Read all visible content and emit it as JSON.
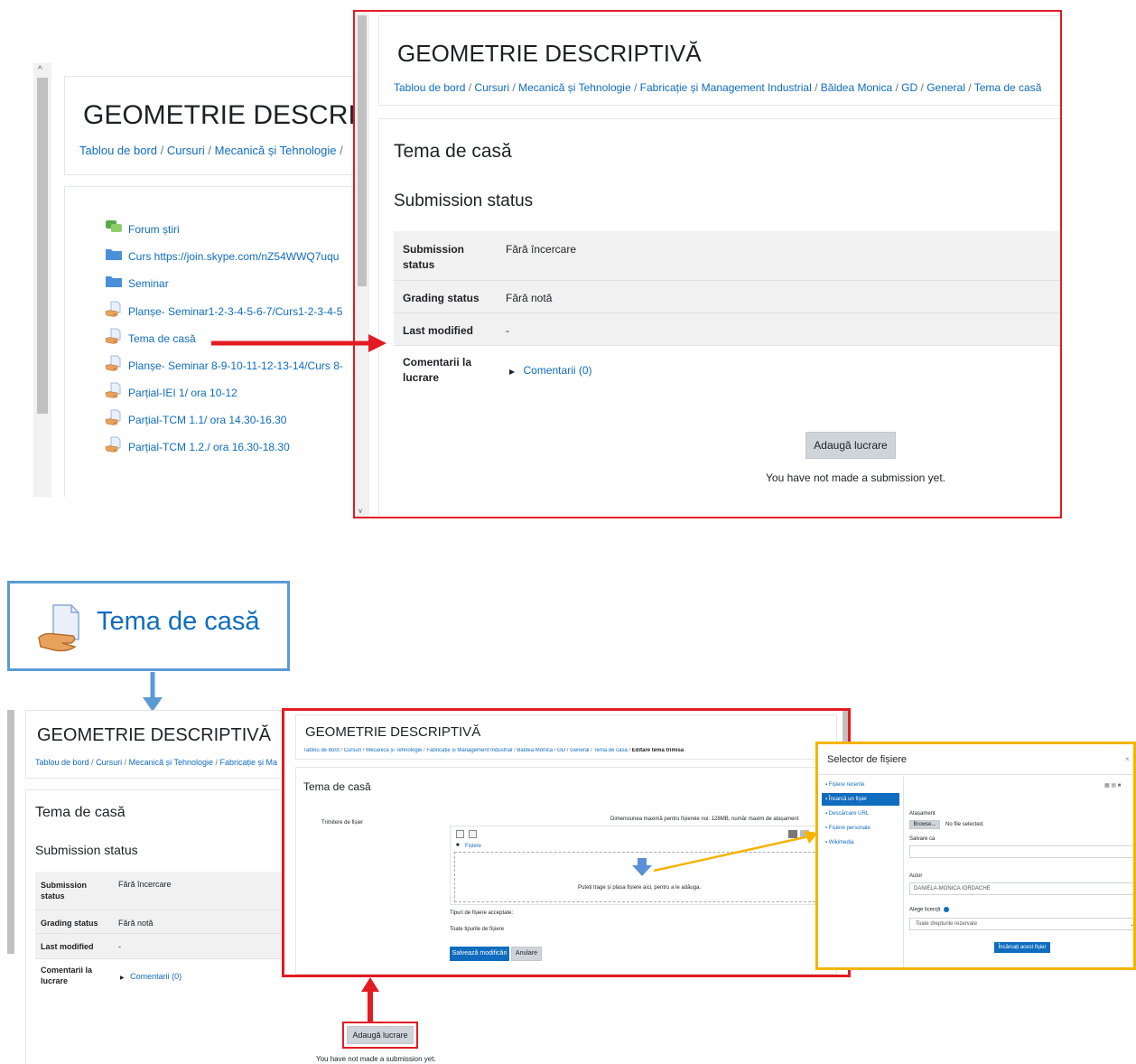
{
  "colors": {
    "red_frame": "#e31b23",
    "blue_frame": "#5b9bd5",
    "yellow_frame": "#f4b400",
    "accent": "#0f6cbf"
  },
  "course_title": "GEOMETRIE DESCRIPTIVĂ",
  "panel_left": {
    "title": "GEOMETRIE DESCRIPTIVĂ",
    "breadcrumb": [
      "Tablou de bord",
      "Cursuri",
      "Mecanică și Tehnologie"
    ],
    "activities": [
      {
        "icon": "forum-icon",
        "label": "Forum știri"
      },
      {
        "icon": "folder-icon",
        "label": "Curs https://join.skype.com/nZ54WWQ7uqu"
      },
      {
        "icon": "folder-icon",
        "label": "Seminar"
      },
      {
        "icon": "assignment-icon",
        "label": "Planșe- Seminar1-2-3-4-5-6-7/Curs1-2-3-4-5"
      },
      {
        "icon": "assignment-icon",
        "label": "Tema de casă"
      },
      {
        "icon": "assignment-icon",
        "label": "Planșe- Seminar 8-9-10-11-12-13-14/Curs 8-"
      },
      {
        "icon": "assignment-icon",
        "label": "Parțial-IEI 1/ ora 10-12"
      },
      {
        "icon": "assignment-icon",
        "label": "Parțial-TCM 1.1/ ora 14.30-16.30"
      },
      {
        "icon": "assignment-icon",
        "label": "Parțial-TCM 1.2./ ora 16.30-18.30"
      }
    ]
  },
  "panel_top_right": {
    "title": "GEOMETRIE DESCRIPTIVĂ",
    "breadcrumb": [
      "Tablou de bord",
      "Cursuri",
      "Mecanică și Tehnologie",
      "Fabricație și Management Industrial",
      "Băldea Monica",
      "GD",
      "General",
      "Tema de casă"
    ],
    "assignment_title": "Tema de casă",
    "status_heading": "Submission status",
    "rows": [
      {
        "label": "Submission status",
        "value": "Fără încercare"
      },
      {
        "label": "Grading status",
        "value": "Fără notă"
      },
      {
        "label": "Last modified",
        "value": "-"
      },
      {
        "label": "Comentarii la lucrare",
        "value": "Comentarii (0)"
      }
    ],
    "add_button": "Adaugă lucrare",
    "note": "You have not made a submission yet."
  },
  "zoom_link": {
    "label": "Tema de casă"
  },
  "panel_bottom_left": {
    "title": "GEOMETRIE DESCRIPTIVĂ",
    "breadcrumb": [
      "Tablou de bord",
      "Cursuri",
      "Mecanică și Tehnologie",
      "Fabricație și Ma"
    ],
    "assignment_title": "Tema de casă",
    "status_heading": "Submission status",
    "rows": [
      {
        "label": "Submission status",
        "value": "Fără încercare"
      },
      {
        "label": "Grading status",
        "value": "Fără notă"
      },
      {
        "label": "Last modified",
        "value": "-"
      },
      {
        "label": "Comentarii la lucrare",
        "value": "Comentarii (0)"
      }
    ],
    "add_button": "Adaugă lucrare",
    "note": "You have not made a submission yet."
  },
  "panel_edit": {
    "title": "GEOMETRIE DESCRIPTIVĂ",
    "breadcrumb": [
      "Tablou de bord",
      "Cursuri",
      "Mecanică și Tehnologie",
      "Fabricație și Management Industrial",
      "Băldea Monica",
      "GD",
      "General",
      "Tema de casă",
      "Editare temă trimisă"
    ],
    "assignment_title": "Tema de casă",
    "field_label": "Trimitere de fișier",
    "limits": "Dimensiunea maximă pentru fișierele noi: 128MB, număr maxim de atașament",
    "folder_label": "Fișiere",
    "drop_hint": "Puteți trage și plasa fișiere aici, pentru a le adăuga.",
    "accepted_label": "Tipuri de fișiere acceptate:",
    "accepted_value": "Toate tipurile de fișiere",
    "save_button": "Salvează modificări",
    "cancel_button": "Anulare"
  },
  "file_picker": {
    "title": "Selector de fișiere",
    "close": "×",
    "repositories": [
      {
        "icon": "recent-files-icon",
        "label": "Fișiere recente"
      },
      {
        "icon": "upload-icon",
        "label": "Încarcă un fișier"
      },
      {
        "icon": "url-icon",
        "label": "Descărcare URL"
      },
      {
        "icon": "personal-files-icon",
        "label": "Fișiere personale"
      },
      {
        "icon": "wikimedia-icon",
        "label": "Wikimedia"
      }
    ],
    "attachment_label": "Atașament",
    "browse_button": "Browse...",
    "no_file": "No file selected.",
    "save_as_label": "Salvare ca",
    "author_label": "Autor",
    "author_value": "DANIELA-MONICA IORDACHE",
    "license_label": "Alege licență",
    "license_value": "Toate drepturile rezervate",
    "upload_button": "Încărcați acest fișier"
  }
}
